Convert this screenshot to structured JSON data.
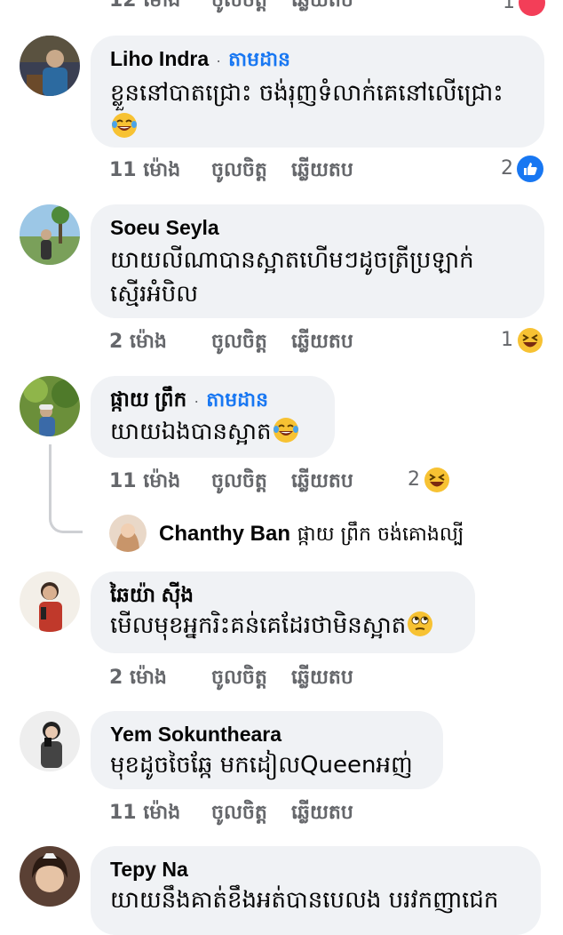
{
  "top_partial": {
    "time": "12 ម៉ោង",
    "like": "ចូលចិត្ត",
    "reply": "ឆ្លើយតប",
    "reaction_count": "1"
  },
  "comments": [
    {
      "name": "Liho Indra",
      "follow": "តាមដាន",
      "text": "ខ្លួននៅបាតជ្រោះ ចង់រុញទំលាក់គេនៅលើជ្រោះ",
      "emoji": "laughing-tears",
      "time": "11 ម៉ោង",
      "like": "ចូលចិត្ត",
      "reply": "ឆ្លើយតប",
      "reaction_count": "2",
      "reaction": "like"
    },
    {
      "name": "Soeu Seyla",
      "text_line1": "យាយលីណាបានស្អាតហើមៗដូចត្រីប្រឡាក់",
      "text_line2": "ស្មើរអំបិល",
      "time": "2 ម៉ោង",
      "like": "ចូលចិត្ត",
      "reply": "ឆ្លើយតប",
      "reaction_count": "1",
      "reaction": "haha"
    },
    {
      "name": "ផ្កាយ ព្រឹក",
      "follow": "តាមដាន",
      "text": "យាយឯងបានស្អាត",
      "emoji": "laughing-tears",
      "time": "11 ម៉ោង",
      "like": "ចូលចិត្ត",
      "reply": "ឆ្លើយតប",
      "reaction_count": "2",
      "reaction": "haha",
      "reply_preview": {
        "name": "Chanthy Ban",
        "text": "ផ្កាយ ព្រឹក ចង់គោងល្បី"
      }
    },
    {
      "name": "ឆៃយ៉ា ស៊ីង",
      "text": "មើលមុខអ្នករិះគន់គេដែរថាមិនស្អាត",
      "emoji": "eye-roll",
      "time": "2 ម៉ោង",
      "like": "ចូលចិត្ត",
      "reply": "ឆ្លើយតប"
    },
    {
      "name": "Yem Sokuntheara",
      "text": "មុខដូចចៃឆ្កែ មកដៀលQueenអញ់",
      "time": "11 ម៉ោង",
      "like": "ចូលចិត្ត",
      "reply": "ឆ្លើយតប"
    },
    {
      "name": "Tepy Na",
      "text": "យាយនឹងគាត់ខឹងអត់បានបេលង បរវកញាជេក"
    }
  ],
  "colors": {
    "bubble": "#f0f2f5",
    "link_blue": "#1877f2",
    "meta_gray": "#65676b"
  }
}
